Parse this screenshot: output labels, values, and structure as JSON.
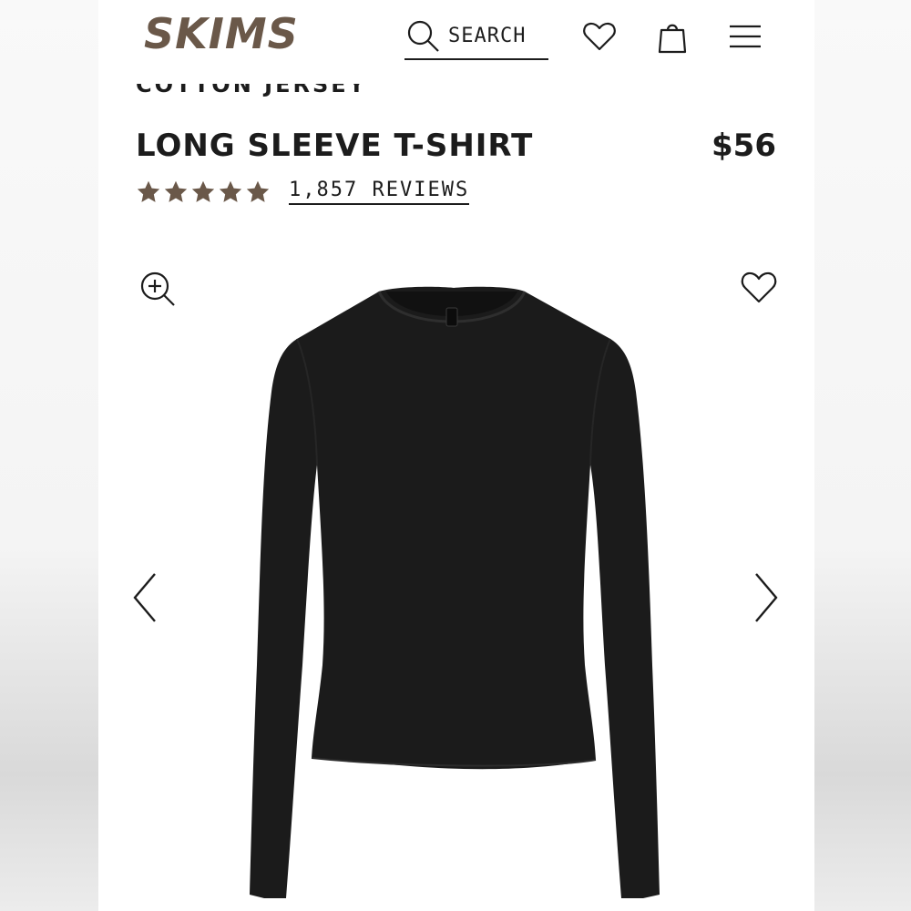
{
  "brand": {
    "logo_text": "SKIMS",
    "logo_color": "#6a5849"
  },
  "header": {
    "search_label": "SEARCH",
    "icons": [
      "search-icon",
      "heart-icon",
      "shopping-bag-icon",
      "menu-icon"
    ]
  },
  "product": {
    "collection": "COTTON JERSEY",
    "title": "LONG SLEEVE T-SHIRT",
    "price": "$56",
    "rating": 5,
    "reviews_label": "1,857 REVIEWS",
    "star_color": "#6a5849",
    "color": "#1b1b1b"
  },
  "gallery": {
    "icons": [
      "zoom-in-icon",
      "heart-icon",
      "chevron-left-icon",
      "chevron-right-icon"
    ]
  }
}
